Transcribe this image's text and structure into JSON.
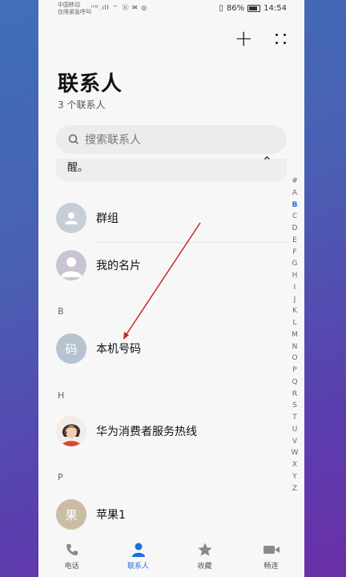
{
  "status_bar": {
    "carrier_line1": "中国移动",
    "carrier_line2": "仅限紧急呼叫",
    "signal_icons": "ᴴᴰ.ıll ⌔ ⓑ ✉ ◎",
    "battery_percent": "86%",
    "time": "14:54"
  },
  "header": {
    "title": "联系人",
    "subtitle": "3 个联系人",
    "add_icon": "plus-icon",
    "more_icon": "more-icon"
  },
  "search": {
    "placeholder": "搜索联系人"
  },
  "notice": {
    "text": "醒。",
    "close": "×"
  },
  "groups": [
    {
      "label": "群组"
    },
    {
      "label": "我的名片"
    }
  ],
  "sections": [
    {
      "letter": "B",
      "contacts": [
        {
          "avatar_text": "码",
          "name": "本机号码"
        }
      ]
    },
    {
      "letter": "H",
      "contacts": [
        {
          "avatar_text": "",
          "name": "华为消费者服务热线"
        }
      ]
    },
    {
      "letter": "P",
      "contacts": [
        {
          "avatar_text": "果",
          "name": "苹果1"
        }
      ]
    }
  ],
  "alphabet_index": [
    "#",
    "A",
    "B",
    "C",
    "D",
    "E",
    "F",
    "G",
    "H",
    "I",
    "J",
    "K",
    "L",
    "M",
    "N",
    "O",
    "P",
    "Q",
    "R",
    "S",
    "T",
    "U",
    "V",
    "W",
    "X",
    "Y",
    "Z"
  ],
  "alphabet_selected": "B",
  "tabs": [
    {
      "label": "电话",
      "icon": "phone-icon",
      "active": false
    },
    {
      "label": "联系人",
      "icon": "contacts-icon",
      "active": true
    },
    {
      "label": "收藏",
      "icon": "star-icon",
      "active": false
    },
    {
      "label": "畅连",
      "icon": "video-icon",
      "active": false
    }
  ],
  "colors": {
    "accent": "#1f6fe0",
    "annotation_arrow": "#c62828"
  }
}
